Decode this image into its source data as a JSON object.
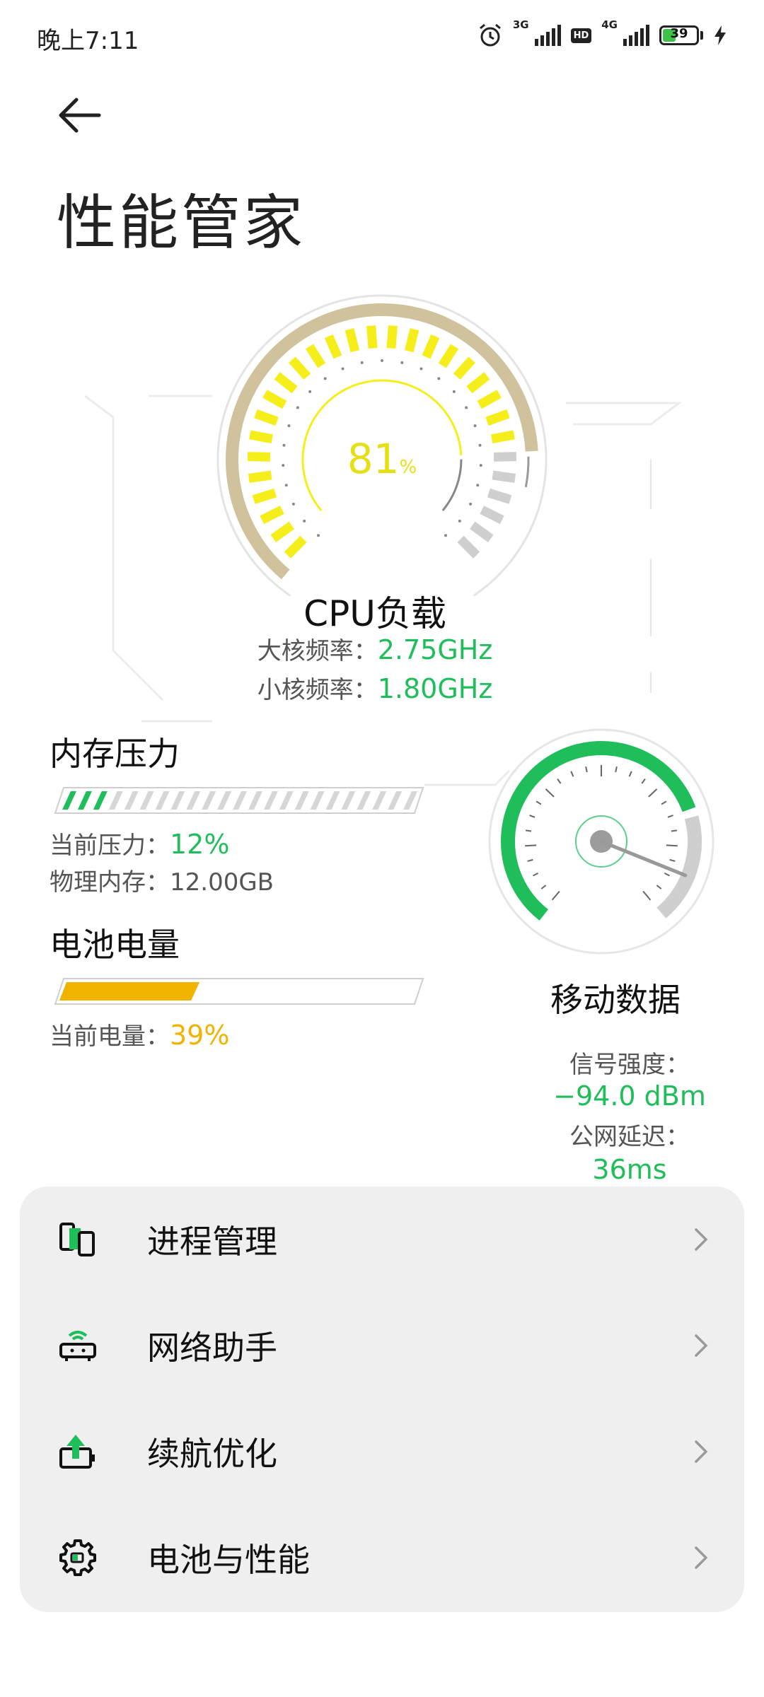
{
  "status_bar": {
    "time": "晚上7:11",
    "network_1": "3G",
    "hd_badge": "HD",
    "network_2": "4G",
    "battery_level": "39",
    "icons": [
      "alarm-icon",
      "signal-icon",
      "hd-icon",
      "signal-icon",
      "battery-icon",
      "charging-icon"
    ]
  },
  "header": {
    "title": "性能管家"
  },
  "cpu": {
    "load_value": "81",
    "load_unit": "%",
    "load_fraction": 0.81,
    "title": "CPU负载",
    "big_core_label": "大核频率：",
    "big_core_value": "2.75GHz",
    "small_core_label": "小核频率：",
    "small_core_value": "1.80GHz"
  },
  "memory": {
    "title": "内存压力",
    "pressure_label": "当前压力：",
    "pressure_value": "12%",
    "pressure_fraction": 0.12,
    "physical_label": "物理内存：",
    "physical_value": "12.00GB"
  },
  "battery": {
    "title": "电池电量",
    "level_label": "当前电量：",
    "level_value": "39%",
    "level_fraction": 0.39
  },
  "mobile_data": {
    "title": "移动数据",
    "signal_label": "信号强度：",
    "signal_value": "−94.0 dBm",
    "latency_label": "公网延迟：",
    "latency_value": "36ms"
  },
  "menu": {
    "items": [
      {
        "label": "进程管理",
        "icon": "process-icon"
      },
      {
        "label": "网络助手",
        "icon": "network-router-icon"
      },
      {
        "label": "续航优化",
        "icon": "battery-boost-icon"
      },
      {
        "label": "电池与性能",
        "icon": "gear-icon"
      }
    ]
  },
  "colors": {
    "accent_green": "#1fbe5a",
    "accent_yellow": "#f0b400",
    "gauge_yellow": "#f5ee1a",
    "gauge_khaki": "#cfc29c"
  }
}
